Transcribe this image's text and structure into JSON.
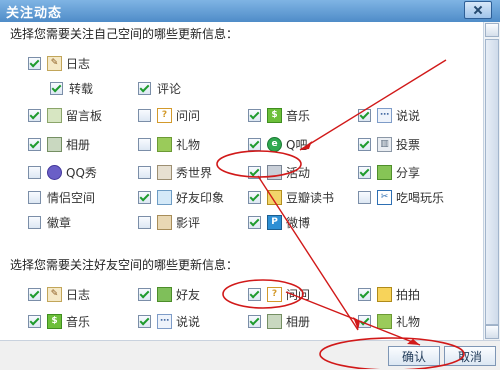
{
  "window": {
    "title": "关注动态"
  },
  "sections": {
    "self_heading": "选择您需要关注自己空间的哪些更新信息：",
    "friend_heading": "选择您需要关注好友空间的哪些更新信息："
  },
  "self_items": [
    {
      "label": "日志",
      "checked": true,
      "icon": "blog-icon"
    },
    {
      "label": "转载",
      "checked": true,
      "icon": ""
    },
    {
      "label": "评论",
      "checked": true,
      "icon": ""
    },
    {
      "label": "留言板",
      "checked": true,
      "icon": "guestbook-icon"
    },
    {
      "label": "问问",
      "checked": false,
      "icon": "question-icon"
    },
    {
      "label": "音乐",
      "checked": true,
      "icon": "music-icon"
    },
    {
      "label": "说说",
      "checked": true,
      "icon": "chat-icon"
    },
    {
      "label": "相册",
      "checked": true,
      "icon": "photo-icon"
    },
    {
      "label": "礼物",
      "checked": false,
      "icon": "gift-icon"
    },
    {
      "label": "Q吧",
      "checked": true,
      "icon": "qbar-icon"
    },
    {
      "label": "投票",
      "checked": true,
      "icon": "vote-icon"
    },
    {
      "label": "QQ秀",
      "checked": false,
      "icon": "qqshow-icon"
    },
    {
      "label": "秀世界",
      "checked": false,
      "icon": "world-icon"
    },
    {
      "label": "活动",
      "checked": true,
      "icon": "speaker-icon"
    },
    {
      "label": "分享",
      "checked": true,
      "icon": "share-icon"
    },
    {
      "label": "情侣空间",
      "checked": false,
      "icon": ""
    },
    {
      "label": "好友印象",
      "checked": true,
      "icon": "impression-icon"
    },
    {
      "label": "豆瓣读书",
      "checked": true,
      "icon": "book-icon"
    },
    {
      "label": "吃喝玩乐",
      "checked": false,
      "icon": "food-icon"
    },
    {
      "label": "徽章",
      "checked": false,
      "icon": ""
    },
    {
      "label": "影评",
      "checked": false,
      "icon": "film-icon"
    },
    {
      "label": "微博",
      "checked": true,
      "icon": "weibo-icon"
    }
  ],
  "friend_items": [
    {
      "label": "日志",
      "checked": true,
      "icon": "blog-icon"
    },
    {
      "label": "好友",
      "checked": true,
      "icon": "friend-icon"
    },
    {
      "label": "问问",
      "checked": true,
      "icon": "question-icon"
    },
    {
      "label": "拍拍",
      "checked": true,
      "icon": "hammer-icon"
    },
    {
      "label": "音乐",
      "checked": true,
      "icon": "music-icon"
    },
    {
      "label": "说说",
      "checked": true,
      "icon": "chat-icon"
    },
    {
      "label": "相册",
      "checked": true,
      "icon": "photo-icon"
    },
    {
      "label": "礼物",
      "checked": true,
      "icon": "gift-icon"
    }
  ],
  "footer": {
    "confirm": "确认",
    "cancel": "取消"
  },
  "colors": {
    "titlebar": "#4f8cc8",
    "check": "#1f9b2e",
    "annotation": "#d11919"
  }
}
